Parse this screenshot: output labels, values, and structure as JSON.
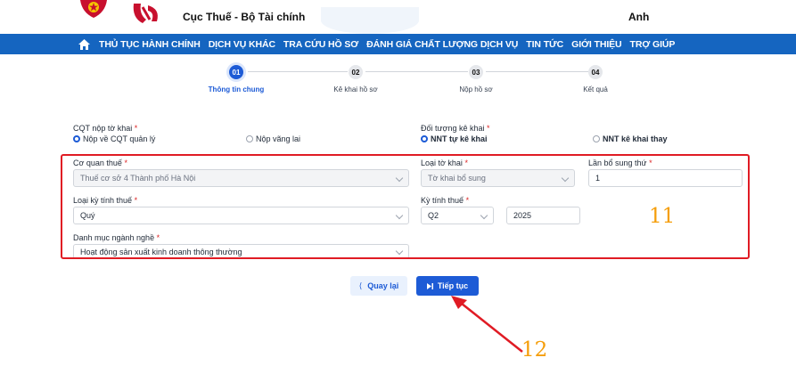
{
  "header": {
    "site_title": "Cục Thuế - Bộ Tài chính",
    "user_name": "Anh"
  },
  "nav": {
    "items": [
      "THỦ TỤC HÀNH CHÍNH",
      "DỊCH VỤ KHÁC",
      "TRA CỨU HỒ SƠ",
      "ĐÁNH GIÁ CHẤT LƯỢNG DỊCH VỤ",
      "TIN TỨC",
      "GIỚI THIỆU",
      "TRỢ GIÚP"
    ]
  },
  "steps": [
    {
      "num": "01",
      "label": "Thông tin chung",
      "active": true
    },
    {
      "num": "02",
      "label": "Kê khai hồ sơ",
      "active": false
    },
    {
      "num": "03",
      "label": "Nộp hồ sơ",
      "active": false
    },
    {
      "num": "04",
      "label": "Kết quả",
      "active": false
    }
  ],
  "form": {
    "cqt_label": "CQT nộp tờ khai",
    "cqt_opt1": "Nộp về CQT quản lý",
    "cqt_opt2": "Nộp vãng lai",
    "doituong_label": "Đối tượng kê khai",
    "doituong_opt1": "NNT tự kê khai",
    "doituong_opt2": "NNT kê khai thay",
    "coquanthue_label": "Cơ quan thuế",
    "coquanthue_value": "Thuế cơ sở 4 Thành phố Hà Nội",
    "loaitokhai_label": "Loại tờ khai",
    "loaitokhai_value": "Tờ khai bổ sung",
    "lanbosung_label": "Lần bổ sung thứ",
    "lanbosung_value": "1",
    "loaikytinhthue_label": "Loại kỳ tính thuế",
    "loaikytinhthue_value": "Quý",
    "kytinhthue_label": "Kỳ tính thuế",
    "kytinhthue_quarter": "Q2",
    "kytinhthue_year": "2025",
    "danhmuc_label": "Danh mục ngành nghề",
    "danhmuc_value": "Hoạt động sản xuất kinh doanh thông thường",
    "required_mark": "*"
  },
  "buttons": {
    "back": "Quay lại",
    "next": "Tiếp tục"
  },
  "annotations": {
    "box_label": "11",
    "arrow_label": "12"
  },
  "colors": {
    "primary": "#1d5bd6",
    "nav_bg": "#1565c0",
    "annotation_red": "#e01b24",
    "annotation_orange": "#f59e0b"
  }
}
